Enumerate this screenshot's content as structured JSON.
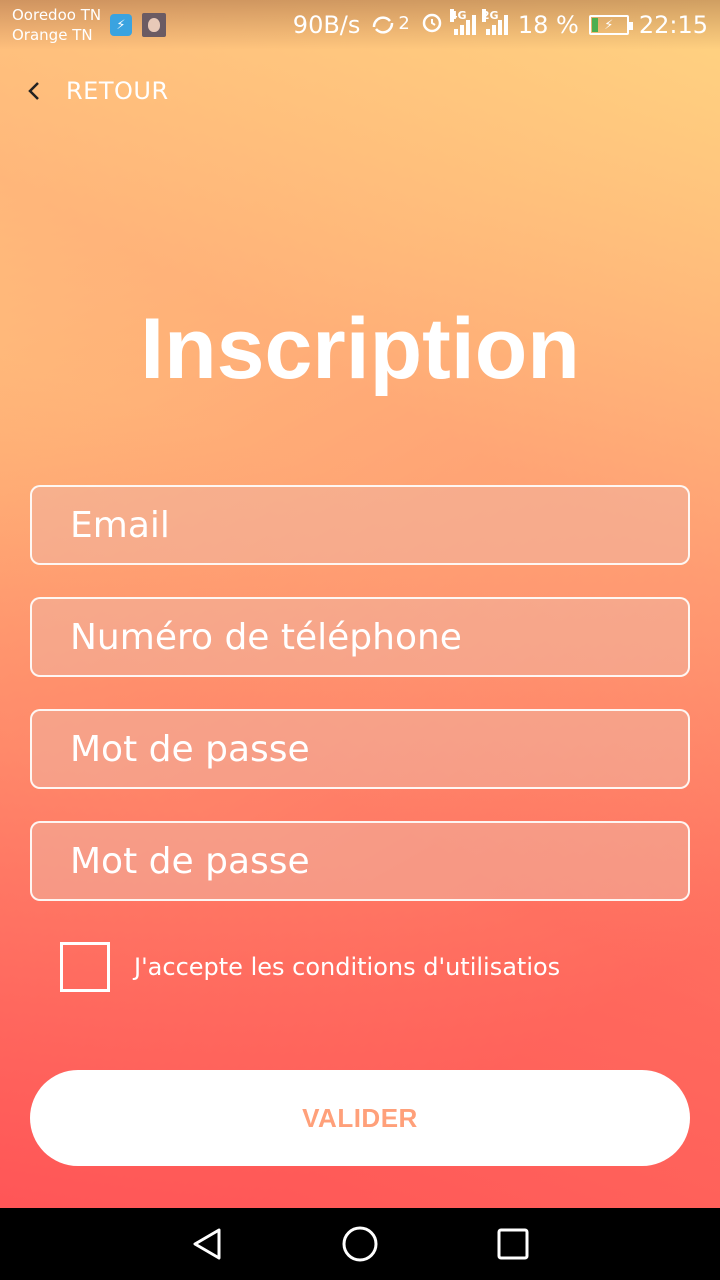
{
  "status_bar": {
    "carrier_1": "Ooredoo TN",
    "carrier_2": "Orange TN",
    "network_speed": "90B/s",
    "sync_count": "2",
    "signal_1_type": "4G",
    "signal_2_type": "2G",
    "battery_percent": "18 %",
    "time": "22:15"
  },
  "header": {
    "back_label": "RETOUR"
  },
  "page": {
    "title": "Inscription"
  },
  "form": {
    "email_placeholder": "Email",
    "phone_placeholder": "Numéro de téléphone",
    "password_placeholder": "Mot de passe",
    "password_confirm_placeholder": "Mot de passe",
    "terms_label": "J'accepte les conditions d'utilisatios",
    "terms_checked": false,
    "submit_label": "VALIDER"
  },
  "colors": {
    "accent_text": "#ffa07a",
    "gradient_top": "#ffd482",
    "gradient_bottom": "#ff5a56"
  },
  "icons": {
    "back": "chevron-left-icon",
    "nav_back": "triangle-back-icon",
    "nav_home": "circle-home-icon",
    "nav_recents": "square-recents-icon"
  }
}
